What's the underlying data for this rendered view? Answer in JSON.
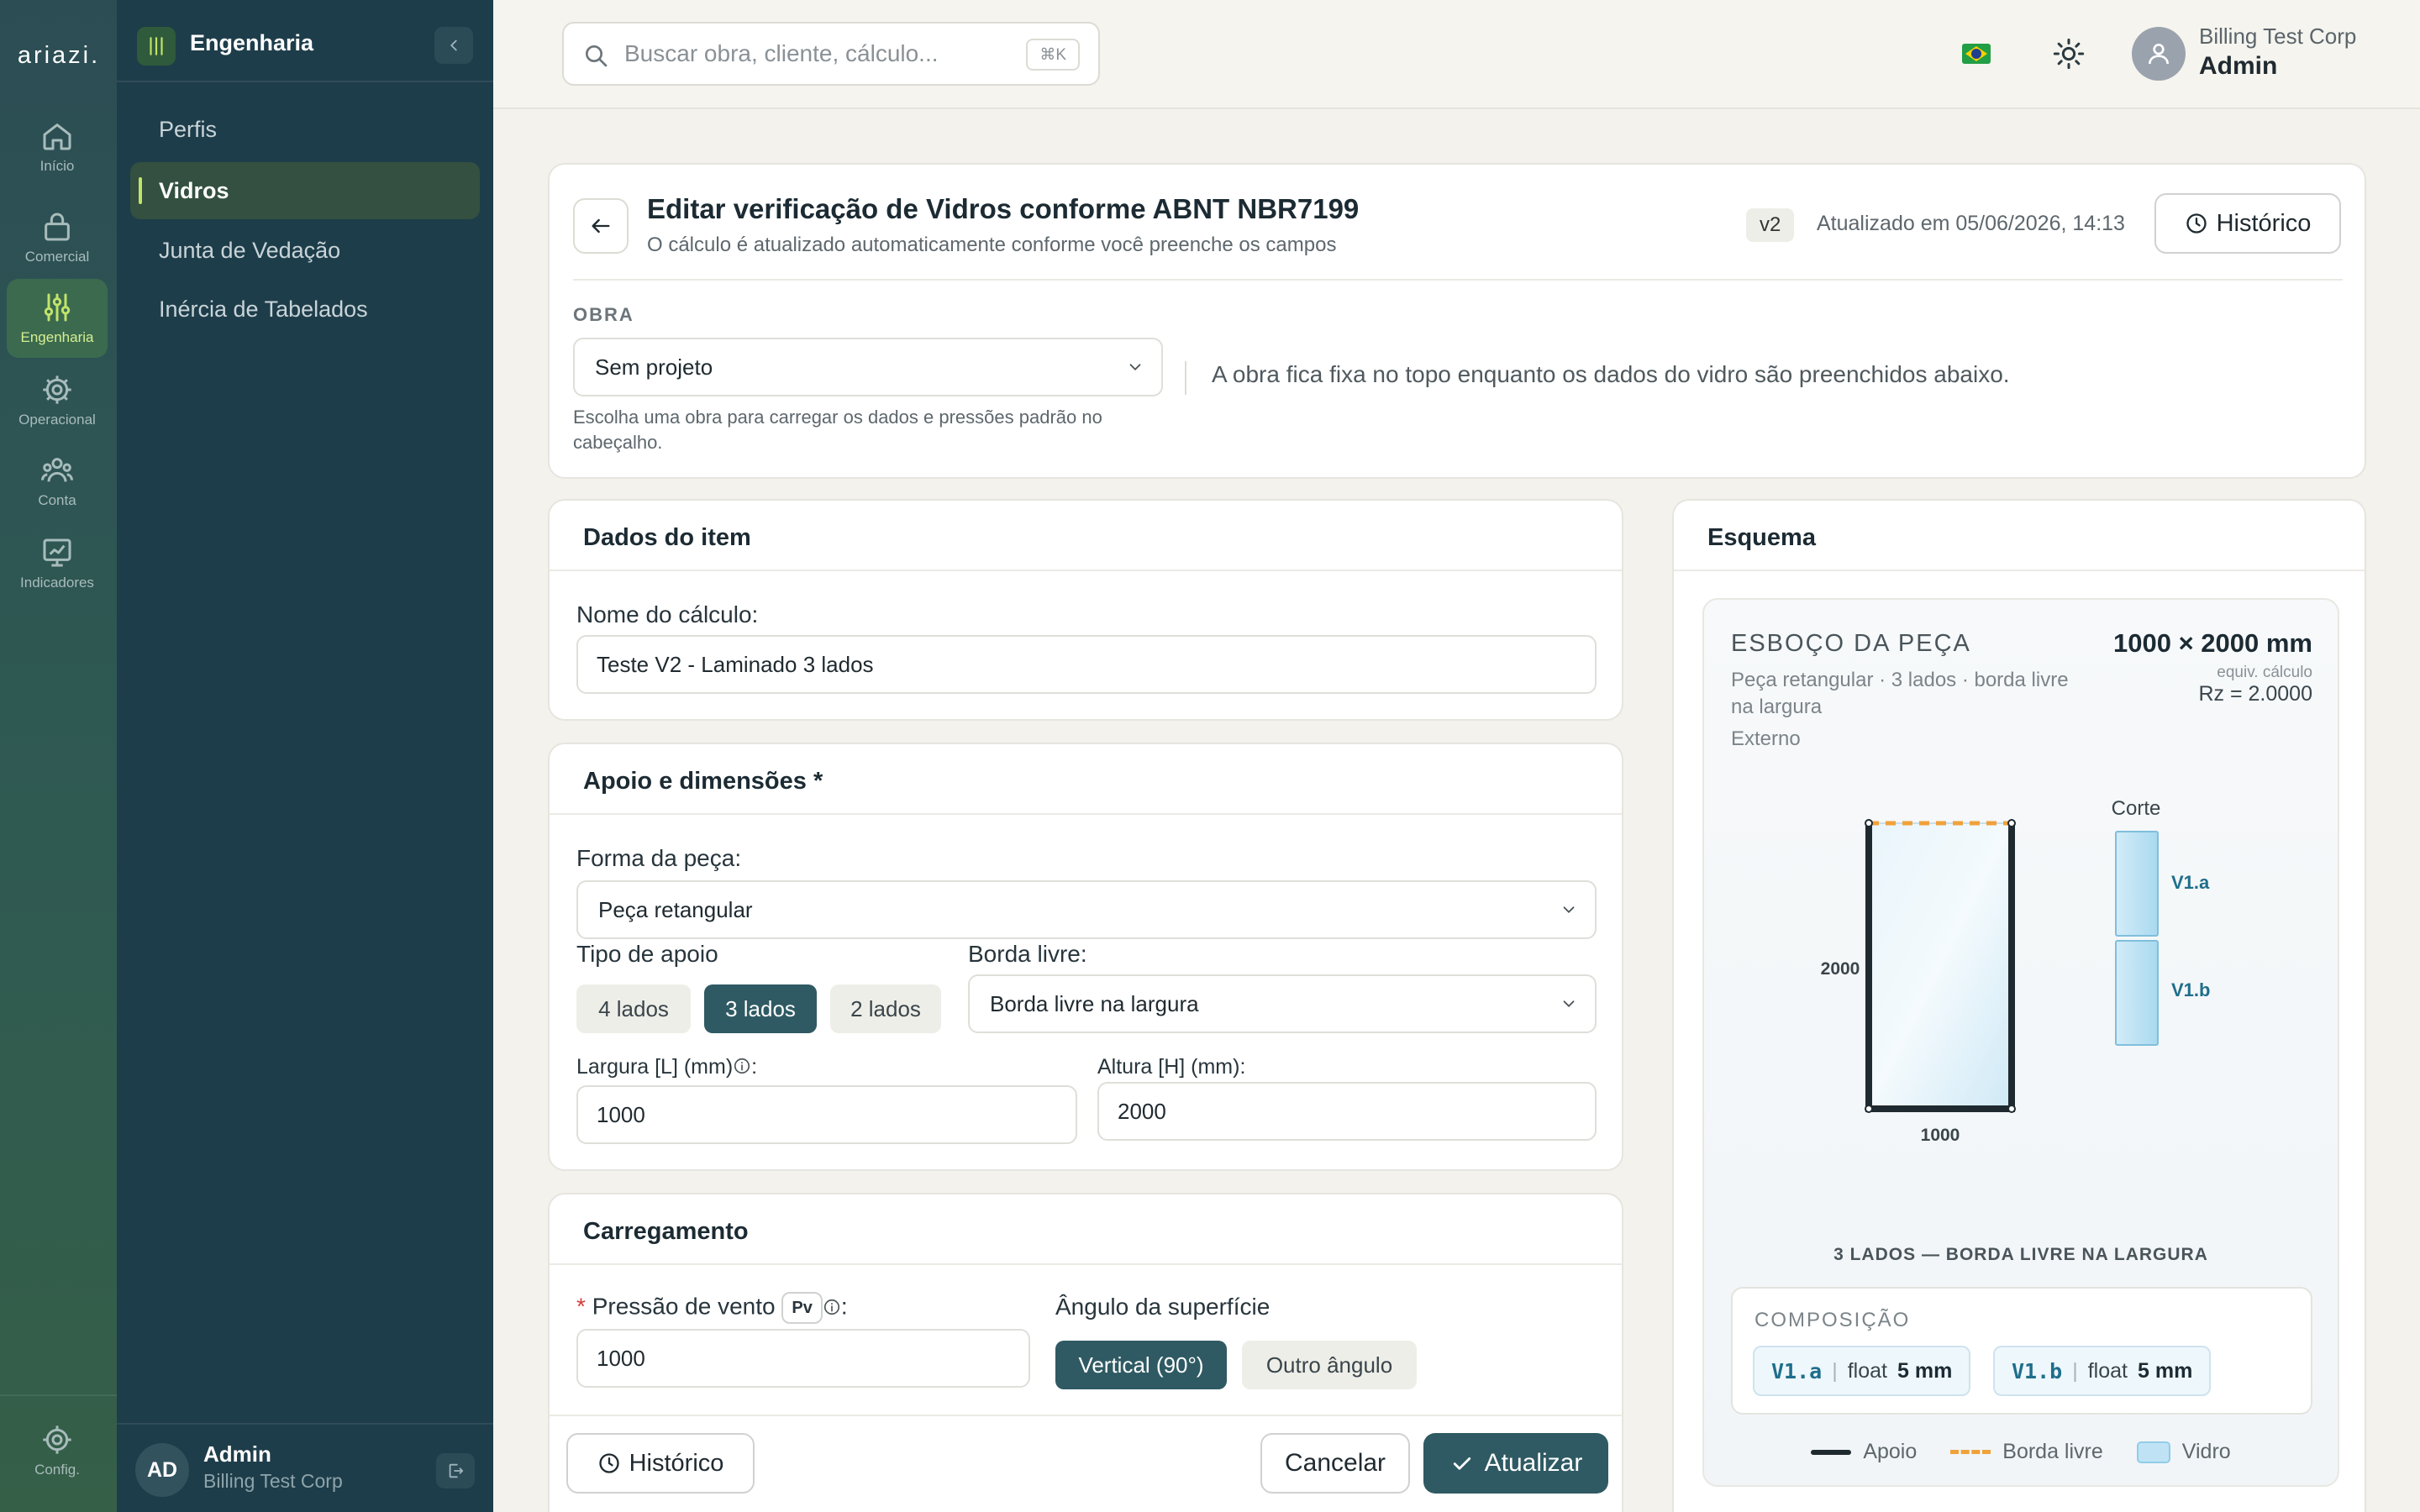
{
  "rail": {
    "logo": "ariazi.",
    "items": [
      {
        "label": "Início",
        "icon": "home-icon"
      },
      {
        "label": "Comercial",
        "icon": "briefcase-icon"
      },
      {
        "label": "Engenharia",
        "icon": "sliders-icon"
      },
      {
        "label": "Operacional",
        "icon": "gear-icon"
      },
      {
        "label": "Conta",
        "icon": "users-icon"
      },
      {
        "label": "Indicadores",
        "icon": "chart-icon"
      }
    ],
    "config_label": "Config."
  },
  "sidebar": {
    "title": "Engenharia",
    "items": [
      {
        "label": "Perfis"
      },
      {
        "label": "Vidros"
      },
      {
        "label": "Junta de Vedação"
      },
      {
        "label": "Inércia de Tabelados"
      }
    ],
    "user": {
      "initials": "AD",
      "name": "Admin",
      "org": "Billing Test Corp"
    }
  },
  "topbar": {
    "search_placeholder": "Buscar obra, cliente, cálculo...",
    "shortcut": "⌘K",
    "org": "Billing Test Corp",
    "role": "Admin"
  },
  "header": {
    "title": "Editar verificação de Vidros conforme ABNT NBR7199",
    "subtitle": "O cálculo é atualizado automaticamente conforme você preenche os campos",
    "version": "v2",
    "updated": "Atualizado em 05/06/2026, 14:13",
    "history_label": "Histórico",
    "obra_label": "OBRA",
    "obra_value": "Sem projeto",
    "obra_help": "Escolha uma obra para carregar os dados e pressões padrão no cabeçalho.",
    "obra_note": "A obra fica fixa no topo enquanto os dados do vidro são preenchidos abaixo."
  },
  "item": {
    "title": "Dados do item",
    "name_label": "Nome do cálculo:",
    "name_value": "Teste V2 - Laminado 3 lados"
  },
  "apoio": {
    "title": "Apoio e dimensões *",
    "forma_label": "Forma da peça:",
    "forma_value": "Peça retangular",
    "tipo_label": "Tipo de apoio",
    "tipo_options": [
      "4 lados",
      "3 lados",
      "2 lados"
    ],
    "tipo_selected": "3 lados",
    "borda_label": "Borda livre:",
    "borda_value": "Borda livre na largura",
    "largura_label": "Largura [L] (mm)",
    "largura_value": "1000",
    "altura_label": "Altura [H] (mm):",
    "altura_value": "2000"
  },
  "carga": {
    "title": "Carregamento",
    "required_mark": "*",
    "pressao_label": "Pressão de vento",
    "pressao_badge": "Pv",
    "pressao_value": "1000",
    "angulo_label": "Ângulo da superfície",
    "angulo_options": [
      "Vertical (90°)",
      "Outro ângulo"
    ],
    "angulo_selected": "Vertical (90°)"
  },
  "footer": {
    "history_label": "Histórico",
    "cancel_label": "Cancelar",
    "update_label": "Atualizar"
  },
  "esquema": {
    "title": "Esquema",
    "sketch_title": "ESBOÇO DA PEÇA",
    "sketch_sub": "Peça retangular · 3 lados · borda livre na largura",
    "sketch_ext": "Externo",
    "dims": "1000 × 2000 mm",
    "equiv": "equiv. cálculo",
    "rz": "Rz = 2.0000",
    "width_label": "1000",
    "height_label": "2000",
    "corte_label": "Corte",
    "layer_a": "V1.a",
    "layer_b": "V1.b",
    "caption": "3 LADOS — BORDA LIVRE NA LARGURA",
    "composition_title": "COMPOSIÇÃO",
    "layers": [
      {
        "code": "V1.a",
        "material": "float",
        "thickness": "5 mm"
      },
      {
        "code": "V1.b",
        "material": "float",
        "thickness": "5 mm"
      }
    ],
    "legend": {
      "apoio": "Apoio",
      "borda": "Borda livre",
      "vidro": "Vidro"
    }
  },
  "colors": {
    "accent": "#2f5a63",
    "lime": "#c2e36a",
    "sidebar": "#1e3d4a",
    "free_edge": "#f0a23a"
  }
}
